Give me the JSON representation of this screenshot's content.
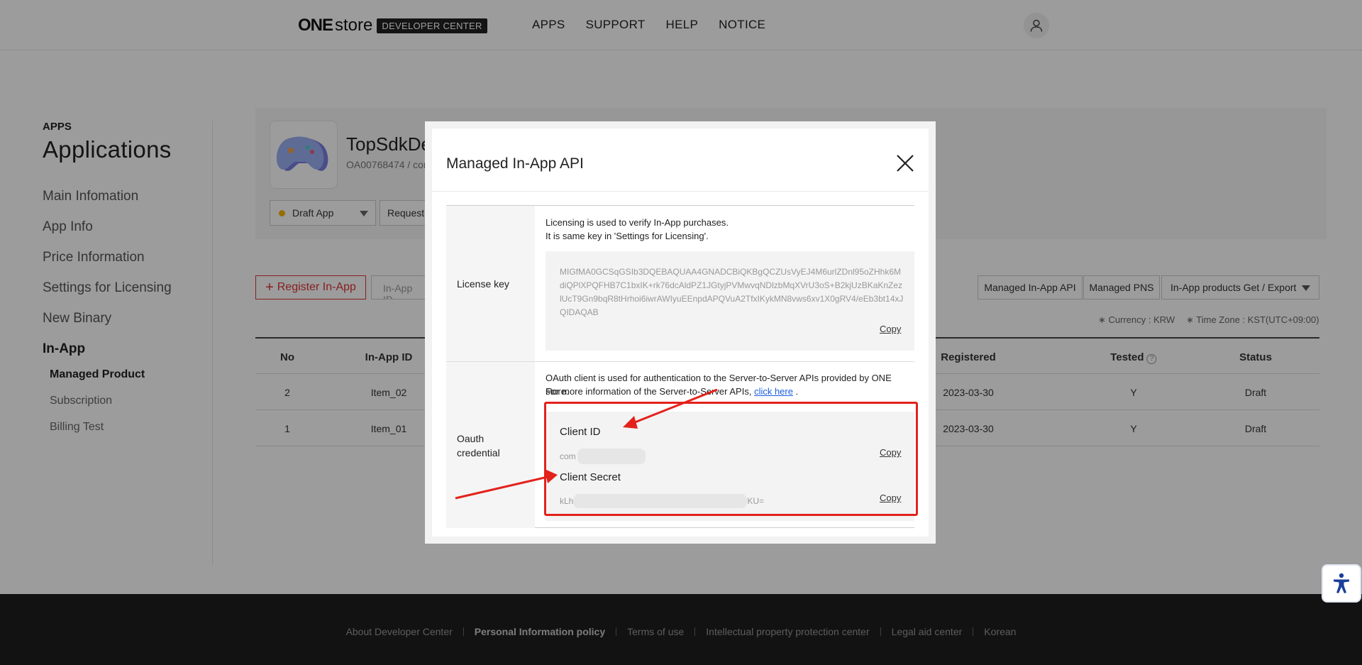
{
  "header": {
    "logo_one": "ONE",
    "logo_store": "store",
    "logo_badge": "DEVELOPER CENTER",
    "nav": [
      "APPS",
      "SUPPORT",
      "HELP",
      "NOTICE"
    ]
  },
  "sidebar": {
    "section": "APPS",
    "title": "Applications",
    "items": [
      "Main Infomation",
      "App Info",
      "Price Information",
      "Settings for Licensing",
      "New Binary",
      "In-App"
    ],
    "sub_items": [
      "Managed Product",
      "Subscription",
      "Billing Test"
    ]
  },
  "app": {
    "name": "TopSdkDe",
    "id_text": "OA00768474 / com",
    "status": "Draft App",
    "request_label": "Request"
  },
  "toolbar": {
    "register_label": "Register In-App",
    "inapp_id_label": "In-App ID",
    "managed_api_label": "Managed In-App API",
    "managed_pns_label": "Managed PNS",
    "export_label": "In-App products Get / Export",
    "currency_note": "Currency : KRW",
    "timezone_note": "Time Zone : KST(UTC+09:00)"
  },
  "table": {
    "headers": {
      "no": "No",
      "inapp_id": "In-App ID",
      "registered": "Registered",
      "tested": "Tested",
      "status": "Status"
    },
    "rows": [
      {
        "no": "2",
        "inapp_id": "Item_02",
        "registered": "2023-03-30",
        "tested": "Y",
        "status": "Draft"
      },
      {
        "no": "1",
        "inapp_id": "Item_01",
        "registered": "2023-03-30",
        "tested": "Y",
        "status": "Draft"
      }
    ]
  },
  "footer": {
    "links": [
      "About Developer Center",
      "Personal Information policy",
      "Terms of use",
      "Intellectual property protection center",
      "Legal aid center",
      "Korean"
    ]
  },
  "modal": {
    "title": "Managed In-App API",
    "license_label": "License key",
    "license_desc_1": "Licensing is used to verify In-App purchases.",
    "license_desc_2": "It is same key in 'Settings for Licensing'.",
    "license_key": "MIGfMA0GCSqGSIb3DQEBAQUAA4GNADCBiQKBgQCZUsVyEJ4M6urlZDnl95oZHhk6MdiQPlXPQFHB7C1bxIK+rk76dcAldPZ1JGtyjPVMwvqNDlzbMqXVrU3oS+B2kjUzBKaKnZezlUcT9Gn9bqR8tHrhoi6iwrAWIyuEEnpdAPQVuA2TfxIKykMN8vws6xv1X0gRV4/eEb3bt14xJQIDAQAB",
    "copy_label": "Copy",
    "oauth_label_1": "Oauth",
    "oauth_label_2": "credential",
    "oauth_desc_1": "OAuth client is used for authentication to the Server-to-Server APIs provided by ONE store.",
    "oauth_desc_2": "For more information of the Server-to-Server APIs,",
    "oauth_link": "click here",
    "client_id_label": "Client ID",
    "client_id_value": "com",
    "client_secret_label": "Client Secret",
    "client_secret_prefix": "kLh",
    "client_secret_suffix": "KU="
  },
  "colors": {
    "accent_red": "#e3221c",
    "link_blue": "#1a5ee0",
    "status_dot": "#f3b400"
  }
}
